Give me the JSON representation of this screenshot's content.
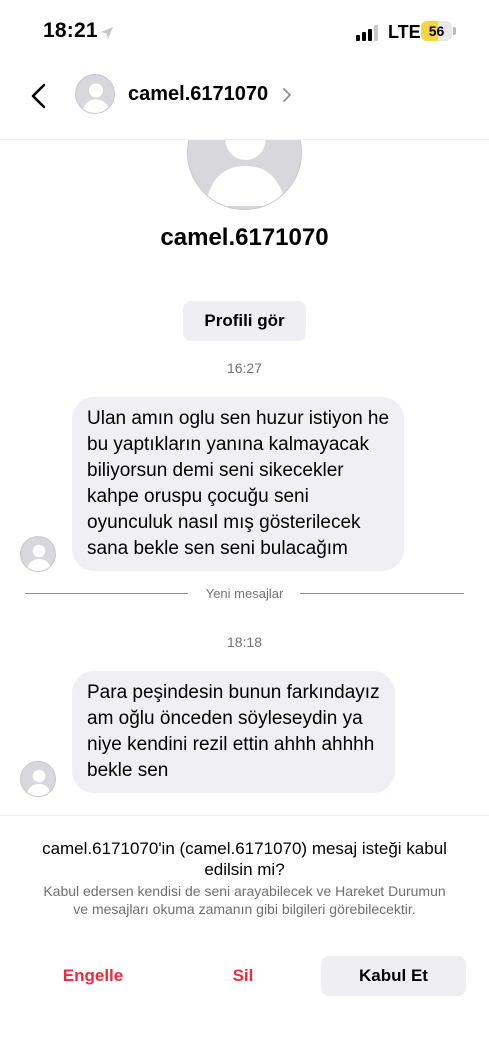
{
  "status_bar": {
    "time": "18:21",
    "network": "LTE",
    "battery_level": "56",
    "battery_fraction": 0.56
  },
  "header": {
    "username": "camel.6171070",
    "icons": [
      "chevron-left-icon",
      "avatar-placeholder-icon",
      "chevron-right-icon"
    ]
  },
  "profile": {
    "username": "camel.6171070",
    "view_profile_label": "Profili gör"
  },
  "conversation": {
    "time_1": "16:27",
    "message_1_lines": [
      "Ulan amın oglu sen huzur istiyon he",
      "bu yaptıkların yanına kalmayacak",
      "biliyorsun demi seni sikecekler",
      "kahpe oruspu çocuğu seni",
      "oyunculuk nasıl mış gösterilecek",
      "sana bekle sen seni bulacağım"
    ],
    "new_messages_label": "Yeni mesajlar",
    "time_2": "18:18",
    "message_2_lines": [
      "Para peşindesin bunun farkındayız",
      "am oğlu önceden söyleseydin ya",
      "niye kendini rezil ettin ahhh ahhhh",
      "bekle sen"
    ]
  },
  "request": {
    "question": "camel.6171070'in (camel.6171070) mesaj isteği kabul edilsin mi?",
    "info": "Kabul edersen kendisi de seni arayabilecek ve Hareket Durumun ve mesajları okuma zamanın gibi bilgileri görebilecektir.",
    "block_label": "Engelle",
    "delete_label": "Sil",
    "accept_label": "Kabul Et",
    "danger_color": "#ed2b3b"
  }
}
